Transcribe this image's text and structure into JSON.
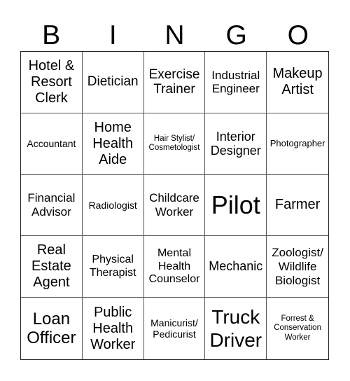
{
  "header": {
    "letters": [
      "B",
      "I",
      "N",
      "G",
      "O"
    ]
  },
  "cells": [
    {
      "text": "Hotel & Resort Clerk",
      "size": "s20"
    },
    {
      "text": "Dietician",
      "size": "s19"
    },
    {
      "text": "Exercise Trainer",
      "size": "s19"
    },
    {
      "text": "Industrial Engineer",
      "size": "s17"
    },
    {
      "text": "Makeup Artist",
      "size": "s20"
    },
    {
      "text": "Accountant",
      "size": "s14"
    },
    {
      "text": "Home Health Aide",
      "size": "s20"
    },
    {
      "text": "Hair Stylist/ Cosmetologist",
      "size": "s11"
    },
    {
      "text": "Interior Designer",
      "size": "s18"
    },
    {
      "text": "Photographer",
      "size": "s13"
    },
    {
      "text": "Financial Advisor",
      "size": "s17"
    },
    {
      "text": "Radiologist",
      "size": "s14"
    },
    {
      "text": "Childcare Worker",
      "size": "s17"
    },
    {
      "text": "Pilot",
      "size": "s36"
    },
    {
      "text": "Farmer",
      "size": "s20"
    },
    {
      "text": "Real Estate Agent",
      "size": "s20"
    },
    {
      "text": "Physical Therapist",
      "size": "s16"
    },
    {
      "text": "Mental Health Counselor",
      "size": "s16"
    },
    {
      "text": "Mechanic",
      "size": "s18"
    },
    {
      "text": "Zoologist/ Wildlife Biologist",
      "size": "s17"
    },
    {
      "text": "Loan Officer",
      "size": "s24"
    },
    {
      "text": "Public Health Worker",
      "size": "s20"
    },
    {
      "text": "Manicurist/ Pedicurist",
      "size": "s14"
    },
    {
      "text": "Truck Driver",
      "size": "s28"
    },
    {
      "text": "Forrest & Conservation Worker",
      "size": "s11"
    }
  ]
}
